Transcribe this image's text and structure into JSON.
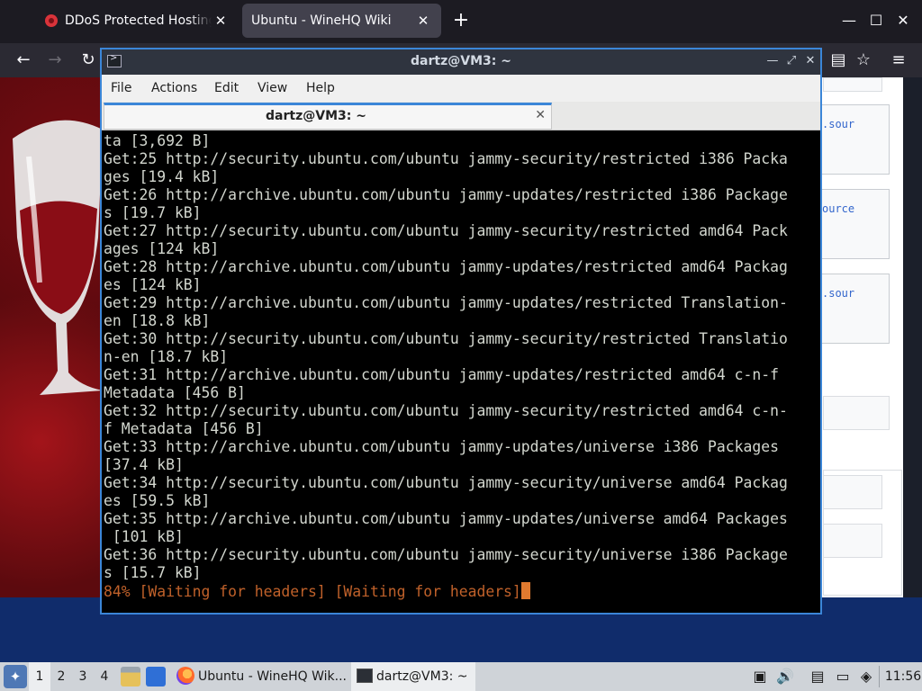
{
  "browser": {
    "tabs": [
      {
        "title": "DDoS Protected Hosting with ...",
        "icon": "site-favicon"
      },
      {
        "title": "Ubuntu - WineHQ Wiki",
        "icon": "none"
      }
    ],
    "new_tab_symbol": "+",
    "window_controls": {
      "minimize": "—",
      "maximize": "☐",
      "close": "✕"
    },
    "nav": {
      "back": "←",
      "forward": "→",
      "reload": "↻",
      "reader": "▤",
      "bookmark": "☆",
      "menu": "≡"
    }
  },
  "webpage": {
    "code_snippets": [
      ".sour",
      "ource",
      ".sour"
    ]
  },
  "terminal": {
    "window_title": "dartz@VM3: ~",
    "controls": {
      "minimize": "—",
      "restore": "⤢",
      "close": "✕"
    },
    "menu": [
      "File",
      "Actions",
      "Edit",
      "View",
      "Help"
    ],
    "tab_title": "dartz@VM3: ~",
    "tab_close": "✕",
    "lines": [
      "ta [3,692 B]",
      "Get:25 http://security.ubuntu.com/ubuntu jammy-security/restricted i386 Packa",
      "ges [19.4 kB]",
      "Get:26 http://archive.ubuntu.com/ubuntu jammy-updates/restricted i386 Package",
      "s [19.7 kB]",
      "Get:27 http://security.ubuntu.com/ubuntu jammy-security/restricted amd64 Pack",
      "ages [124 kB]",
      "Get:28 http://archive.ubuntu.com/ubuntu jammy-updates/restricted amd64 Packag",
      "es [124 kB]",
      "Get:29 http://archive.ubuntu.com/ubuntu jammy-updates/restricted Translation-",
      "en [18.8 kB]",
      "Get:30 http://security.ubuntu.com/ubuntu jammy-security/restricted Translatio",
      "n-en [18.7 kB]",
      "Get:31 http://archive.ubuntu.com/ubuntu jammy-updates/restricted amd64 c-n-f",
      "Metadata [456 B]",
      "Get:32 http://security.ubuntu.com/ubuntu jammy-security/restricted amd64 c-n-",
      "f Metadata [456 B]",
      "Get:33 http://archive.ubuntu.com/ubuntu jammy-updates/universe i386 Packages",
      "[37.4 kB]",
      "Get:34 http://security.ubuntu.com/ubuntu jammy-security/universe amd64 Packag",
      "es [59.5 kB]",
      "Get:35 http://archive.ubuntu.com/ubuntu jammy-updates/universe amd64 Packages",
      " [101 kB]",
      "Get:36 http://security.ubuntu.com/ubuntu jammy-security/universe i386 Package",
      "s [15.7 kB]"
    ],
    "progress_line": "84% [Waiting for headers] [Waiting for headers]",
    "progress_color": "#c0612a",
    "cursor_color": "#e07a2f"
  },
  "taskbar": {
    "workspaces": [
      "1",
      "2",
      "3",
      "4"
    ],
    "active_workspace": "1",
    "tasks": [
      {
        "label": "Ubuntu - WineHQ Wik...",
        "icon": "firefox-icon"
      },
      {
        "label": "dartz@VM3: ~",
        "icon": "terminal-icon"
      }
    ],
    "clock": "11:56"
  },
  "colors": {
    "accent": "#3b86d8",
    "taskbar_bg": "#cfd3d8",
    "desktop_bg": "#102c6b"
  }
}
